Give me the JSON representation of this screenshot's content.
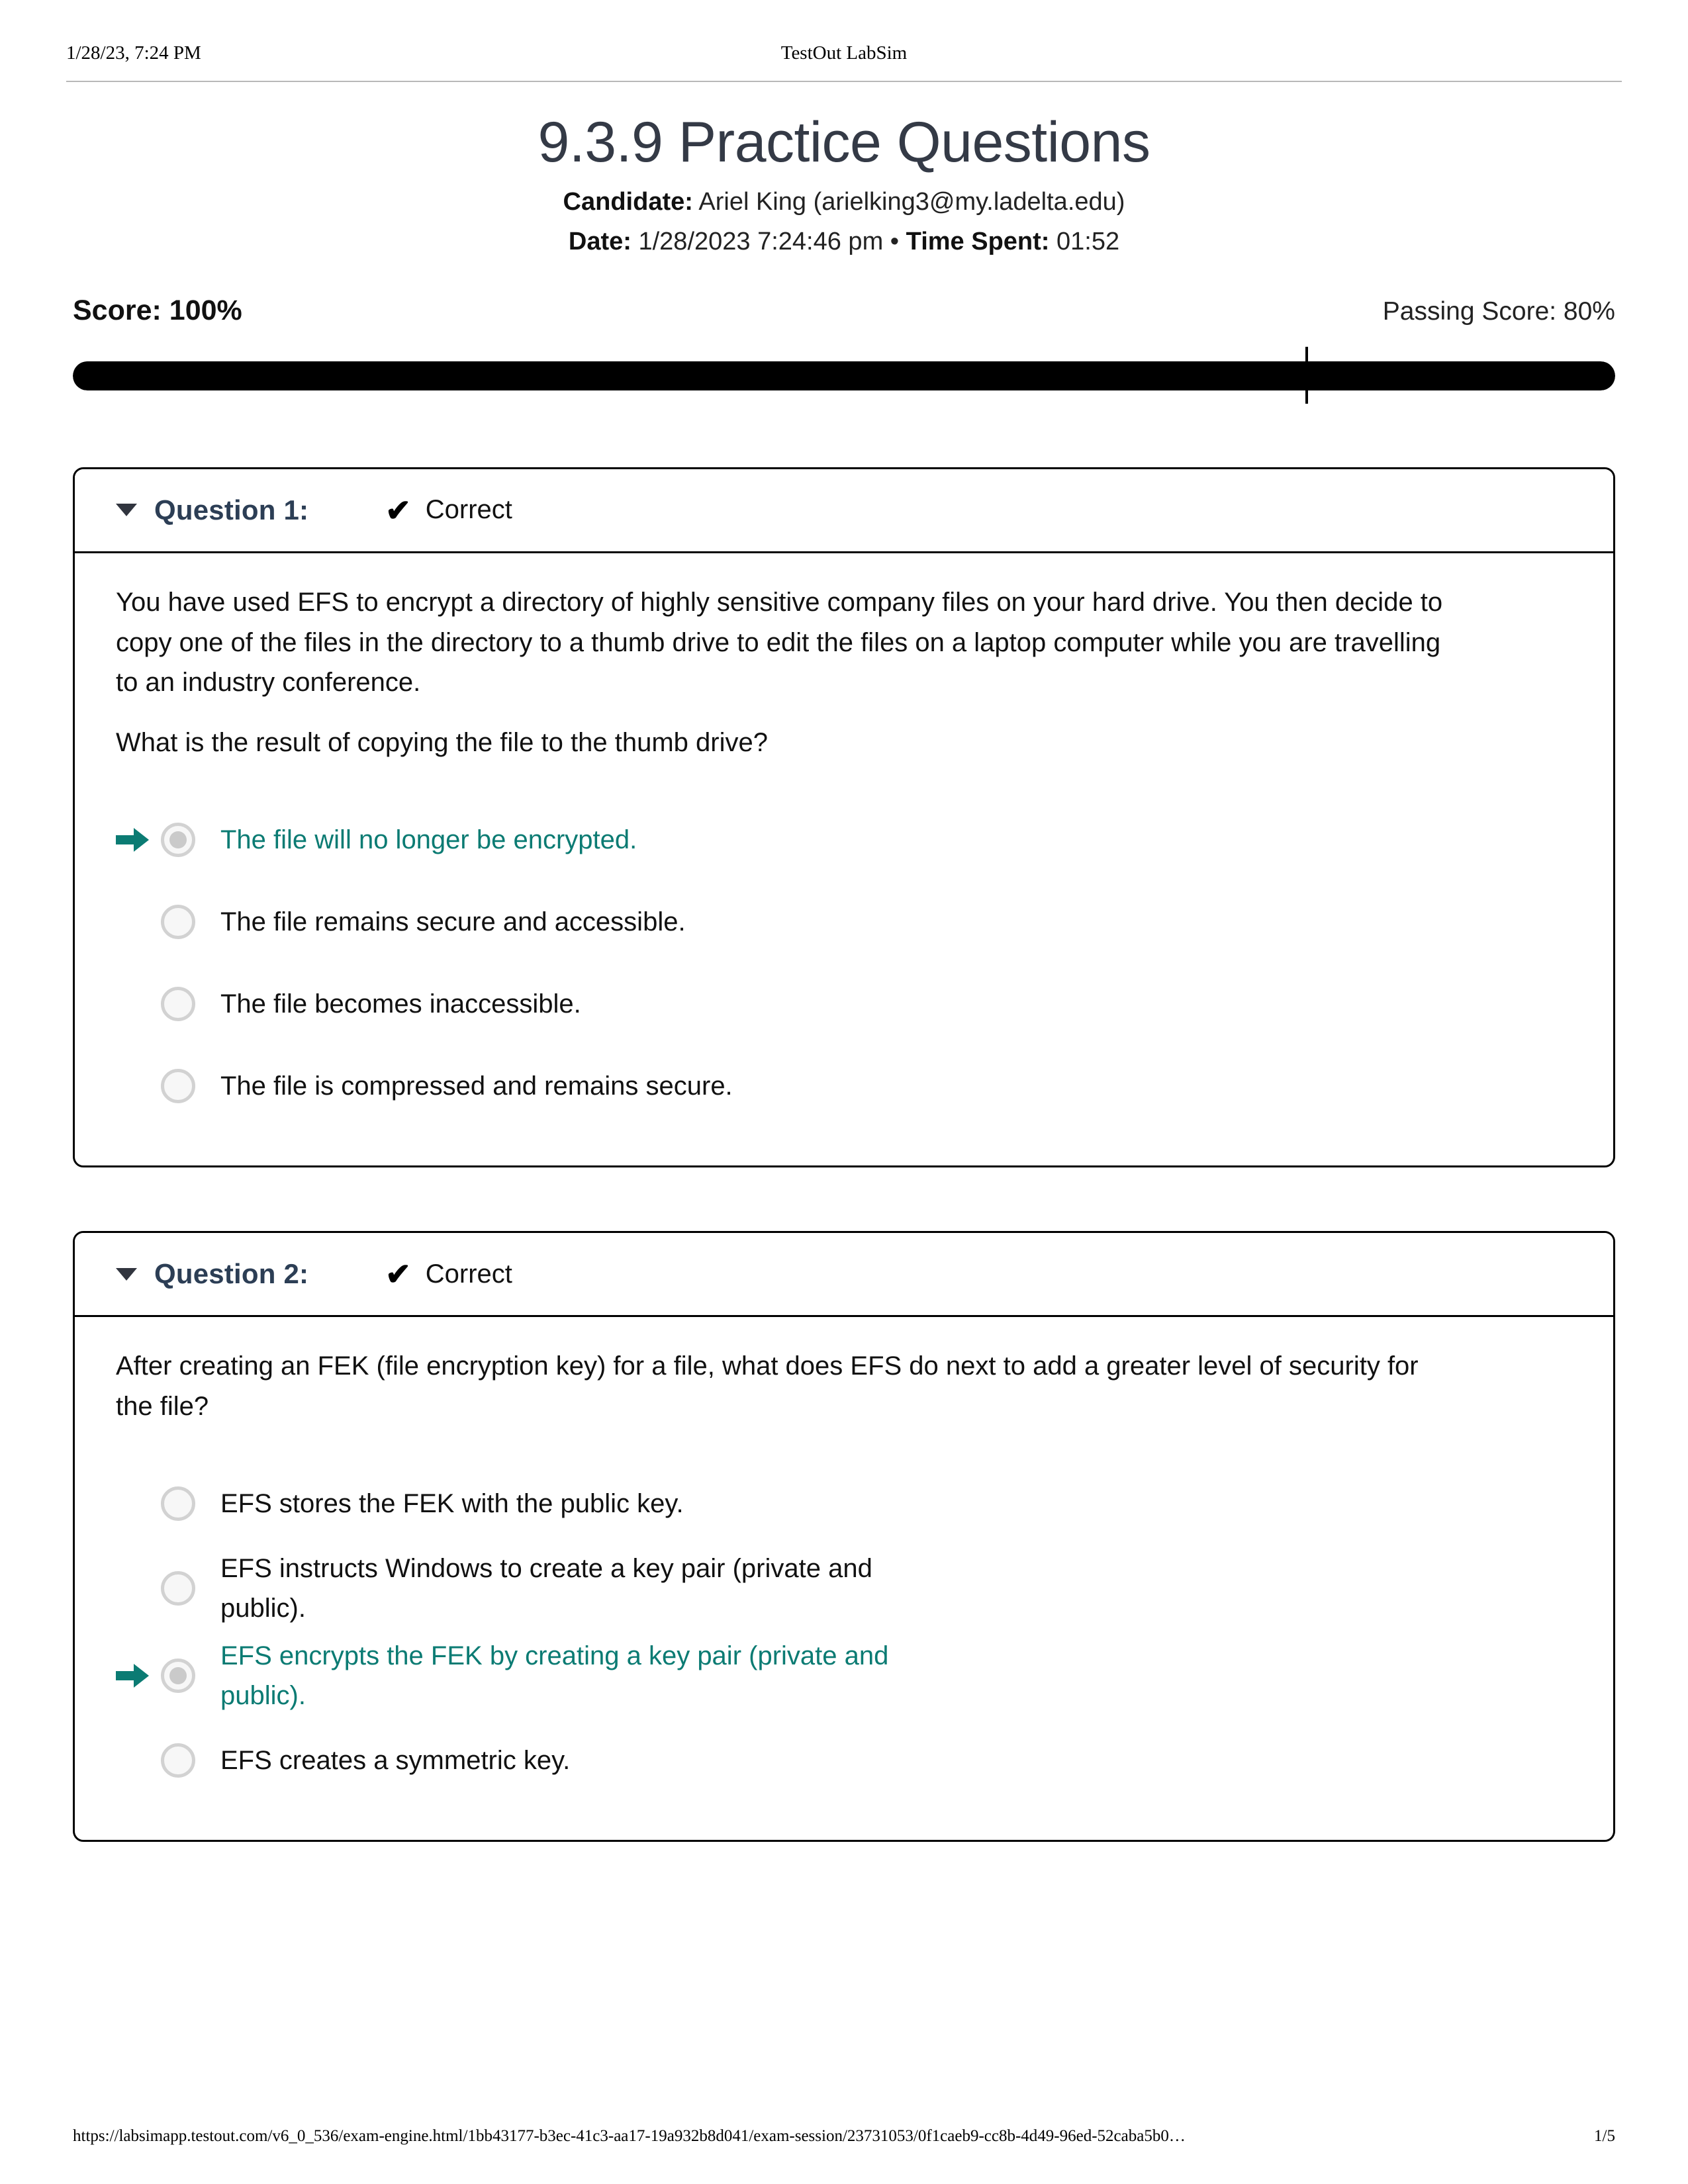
{
  "print_header": {
    "left": "1/28/23, 7:24 PM",
    "center": "TestOut LabSim"
  },
  "title": "9.3.9 Practice Questions",
  "meta": {
    "candidate_label": "Candidate:",
    "candidate_value": "Ariel King  (arielking3@my.ladelta.edu)",
    "date_label": "Date:",
    "date_value": "1/28/2023 7:24:46 pm",
    "separator": "•",
    "time_label": "Time Spent:",
    "time_value": "01:52"
  },
  "score": {
    "label": "Score: 100%",
    "passing_label": "Passing Score: 80%",
    "value_percent": 100,
    "passing_percent": 80,
    "fill_color": "#000000",
    "track_color": "#e6e6e6",
    "marker_color": "#000000"
  },
  "accent_color": "#0b7b73",
  "question_label_color": "#2c3e55",
  "questions": [
    {
      "label": "Question 1:",
      "status": "Correct",
      "status_icon": "check-icon",
      "caret_icon": "caret-down-icon",
      "paragraphs": [
        "You have used EFS to encrypt a directory of highly sensitive company files on your hard drive. You then decide to copy one of the files in the directory to a thumb drive to edit the files on a laptop computer while you are travelling to an industry conference.",
        "What is the result of copying the file to the thumb drive?"
      ],
      "options": [
        {
          "text": "The file will no longer be encrypted.",
          "selected": true
        },
        {
          "text": "The file remains secure and accessible.",
          "selected": false
        },
        {
          "text": "The file becomes inaccessible.",
          "selected": false
        },
        {
          "text": "The file is compressed and remains secure.",
          "selected": false
        }
      ]
    },
    {
      "label": "Question 2:",
      "status": "Correct",
      "status_icon": "check-icon",
      "caret_icon": "caret-down-icon",
      "paragraphs": [
        "After creating an FEK (file encryption key) for a file, what does EFS do next to add a greater level of security for the file?"
      ],
      "options": [
        {
          "text": "EFS stores the FEK with the public key.",
          "selected": false
        },
        {
          "text": "EFS instructs Windows to create a key pair (private and public).",
          "selected": false
        },
        {
          "text": "EFS encrypts the FEK by creating a key pair (private and public).",
          "selected": true
        },
        {
          "text": "EFS creates a symmetric key.",
          "selected": false
        }
      ]
    }
  ],
  "print_footer": {
    "url": "https://labsimapp.testout.com/v6_0_536/exam-engine.html/1bb43177-b3ec-41c3-aa17-19a932b8d041/exam-session/23731053/0f1caeb9-cc8b-4d49-96ed-52caba5b0…",
    "page": "1/5"
  }
}
